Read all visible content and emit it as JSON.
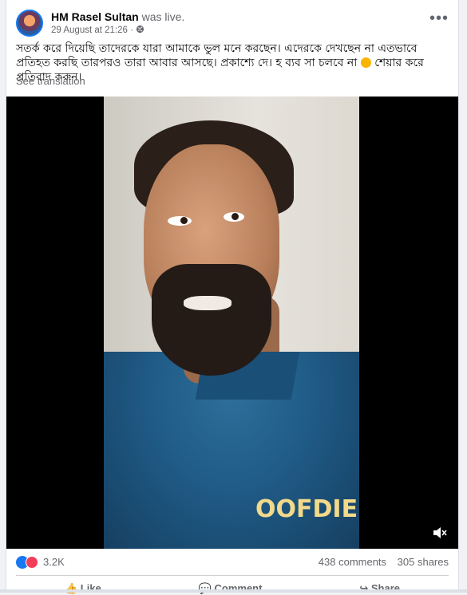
{
  "post": {
    "author": "HM Rasel Sultan",
    "action": "was live.",
    "date": "29 August at 21:26 ·",
    "text": "সতর্ক করে দিয়েছি তাদেরকে যারা আমাকে ভুল মনে করছেন। এদেরকে দেখছেন না এতভাবে প্রতিহত করছি তারপরও তারা আবার আসছে। প্রকাশ্যে দে। হ ব্যব সা চলবে না",
    "text_end": "শেয়ার করে প্রতিবাদ করুন।",
    "translate_label": "See translation",
    "more_icon": "more-horizontal-icon"
  },
  "video": {
    "shirt_text": "OOFDIE",
    "mute_icon": "volume-muted-icon"
  },
  "stats": {
    "reactions": "3.2K",
    "comments": "438 comments",
    "shares": "305 shares"
  },
  "actions": {
    "like": "Like",
    "comment": "Comment",
    "share": "Share"
  }
}
